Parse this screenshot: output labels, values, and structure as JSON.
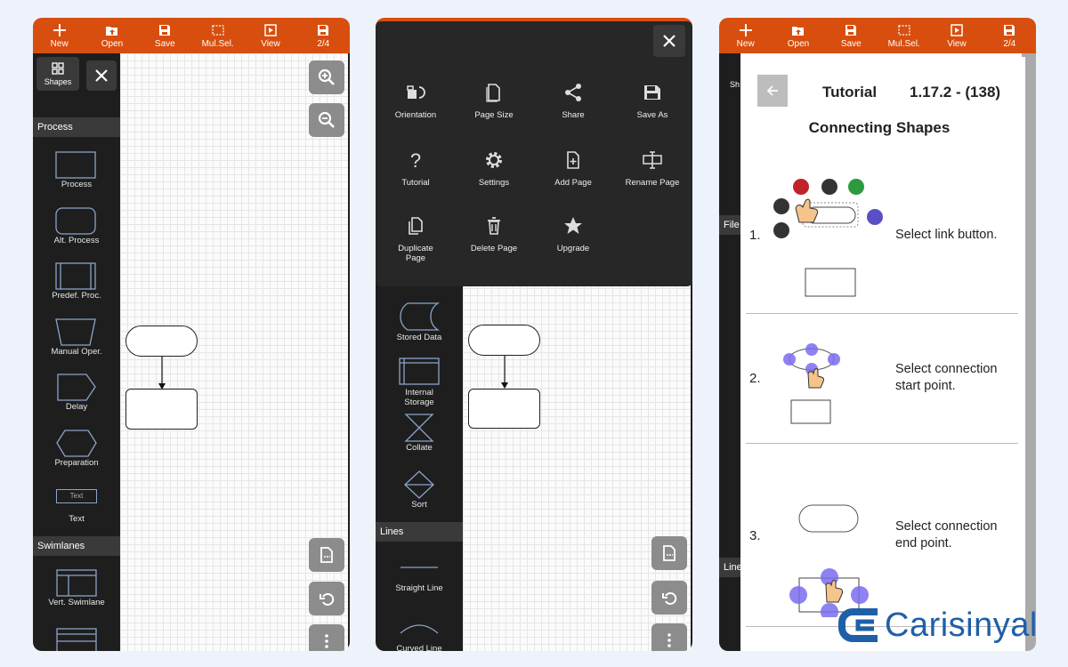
{
  "toolbar": {
    "new_label": "New",
    "open_label": "Open",
    "save_label": "Save",
    "mulsel_label": "Mul.Sel.",
    "view_label": "View",
    "page_indicator": "2/4"
  },
  "screen1": {
    "shapes_tab_label": "Shapes",
    "sections": {
      "process": "Process",
      "swimlanes": "Swimlanes"
    },
    "shapes": [
      "Process",
      "Alt. Process",
      "Predef. Proc.",
      "Manual Oper.",
      "Delay",
      "Preparation",
      "Text",
      "Vert. Swimlane"
    ],
    "text_shape_inner": "Text"
  },
  "screen2": {
    "menu": [
      "Orientation",
      "Page Size",
      "Share",
      "Save As",
      "Tutorial",
      "Settings",
      "Add Page",
      "Rename Page",
      "Duplicate Page",
      "Delete Page",
      "Upgrade"
    ],
    "shapes": [
      "Stored Data",
      "Internal Storage",
      "Collate",
      "Sort"
    ],
    "lines_section": "Lines",
    "lines": [
      "Straight Line",
      "Curved Line"
    ]
  },
  "screen3": {
    "title": "Tutorial",
    "version": "1.17.2 - (138)",
    "subtitle": "Connecting Shapes",
    "steps": [
      {
        "num": "1.",
        "text": "Select link button."
      },
      {
        "num": "2.",
        "text": "Select connection start point."
      },
      {
        "num": "3.",
        "text": "Select connection end point."
      }
    ],
    "sidebar_fragments": {
      "file": "File",
      "lines": "Line",
      "shapes": "Sh"
    }
  },
  "brand": {
    "name": "Carisinyal",
    "color": "#1f5fa8"
  },
  "colors": {
    "toolbar": "#d84e0f",
    "sidebar": "#1e1e1e",
    "accent_blue": "#7a6cf0"
  }
}
